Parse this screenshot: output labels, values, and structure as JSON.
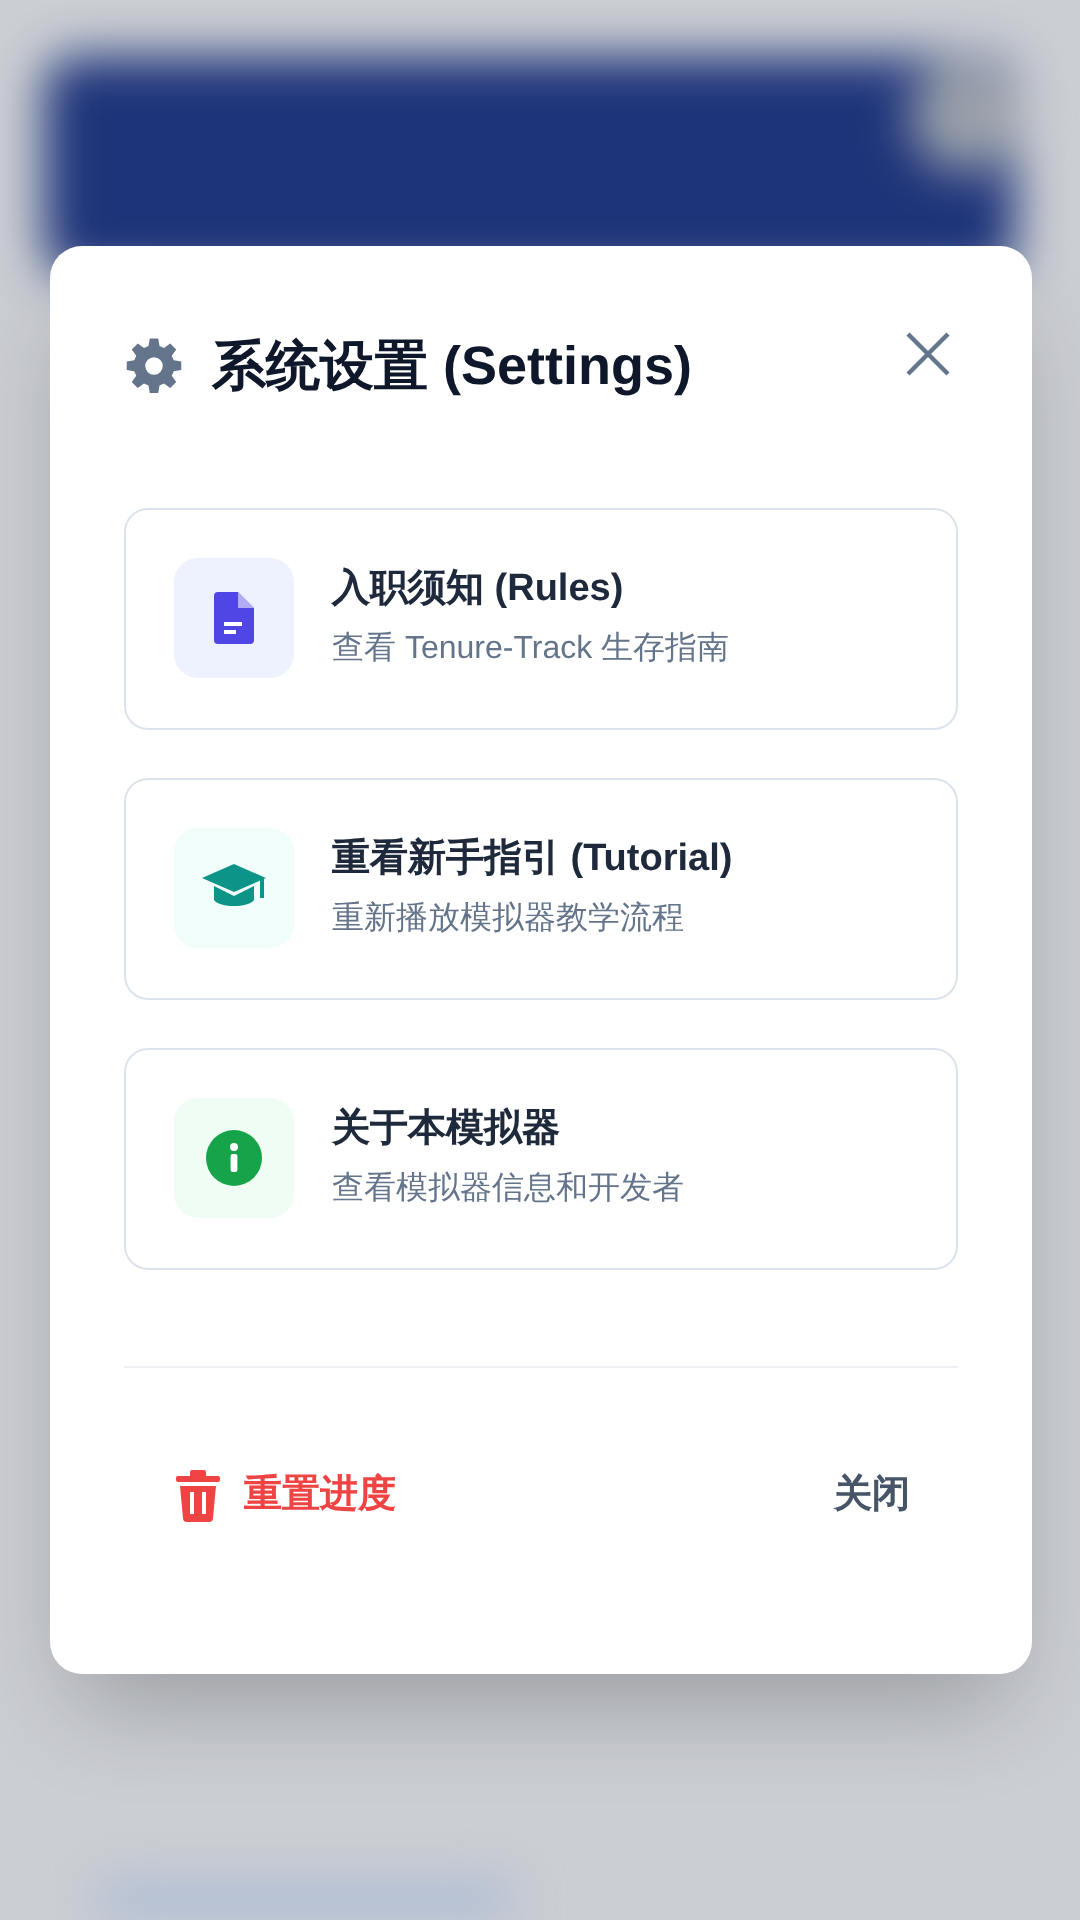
{
  "dialog": {
    "title": "系统设置 (Settings)",
    "items": [
      {
        "kind": "rules",
        "title": "入职须知 (Rules)",
        "subtitle": "查看 Tenure-Track 生存指南"
      },
      {
        "kind": "tutorial",
        "title": "重看新手指引 (Tutorial)",
        "subtitle": "重新播放模拟器教学流程"
      },
      {
        "kind": "about",
        "title": "关于本模拟器",
        "subtitle": "查看模拟器信息和开发者"
      }
    ],
    "reset_button": "重置进度",
    "close_button": "关闭"
  }
}
